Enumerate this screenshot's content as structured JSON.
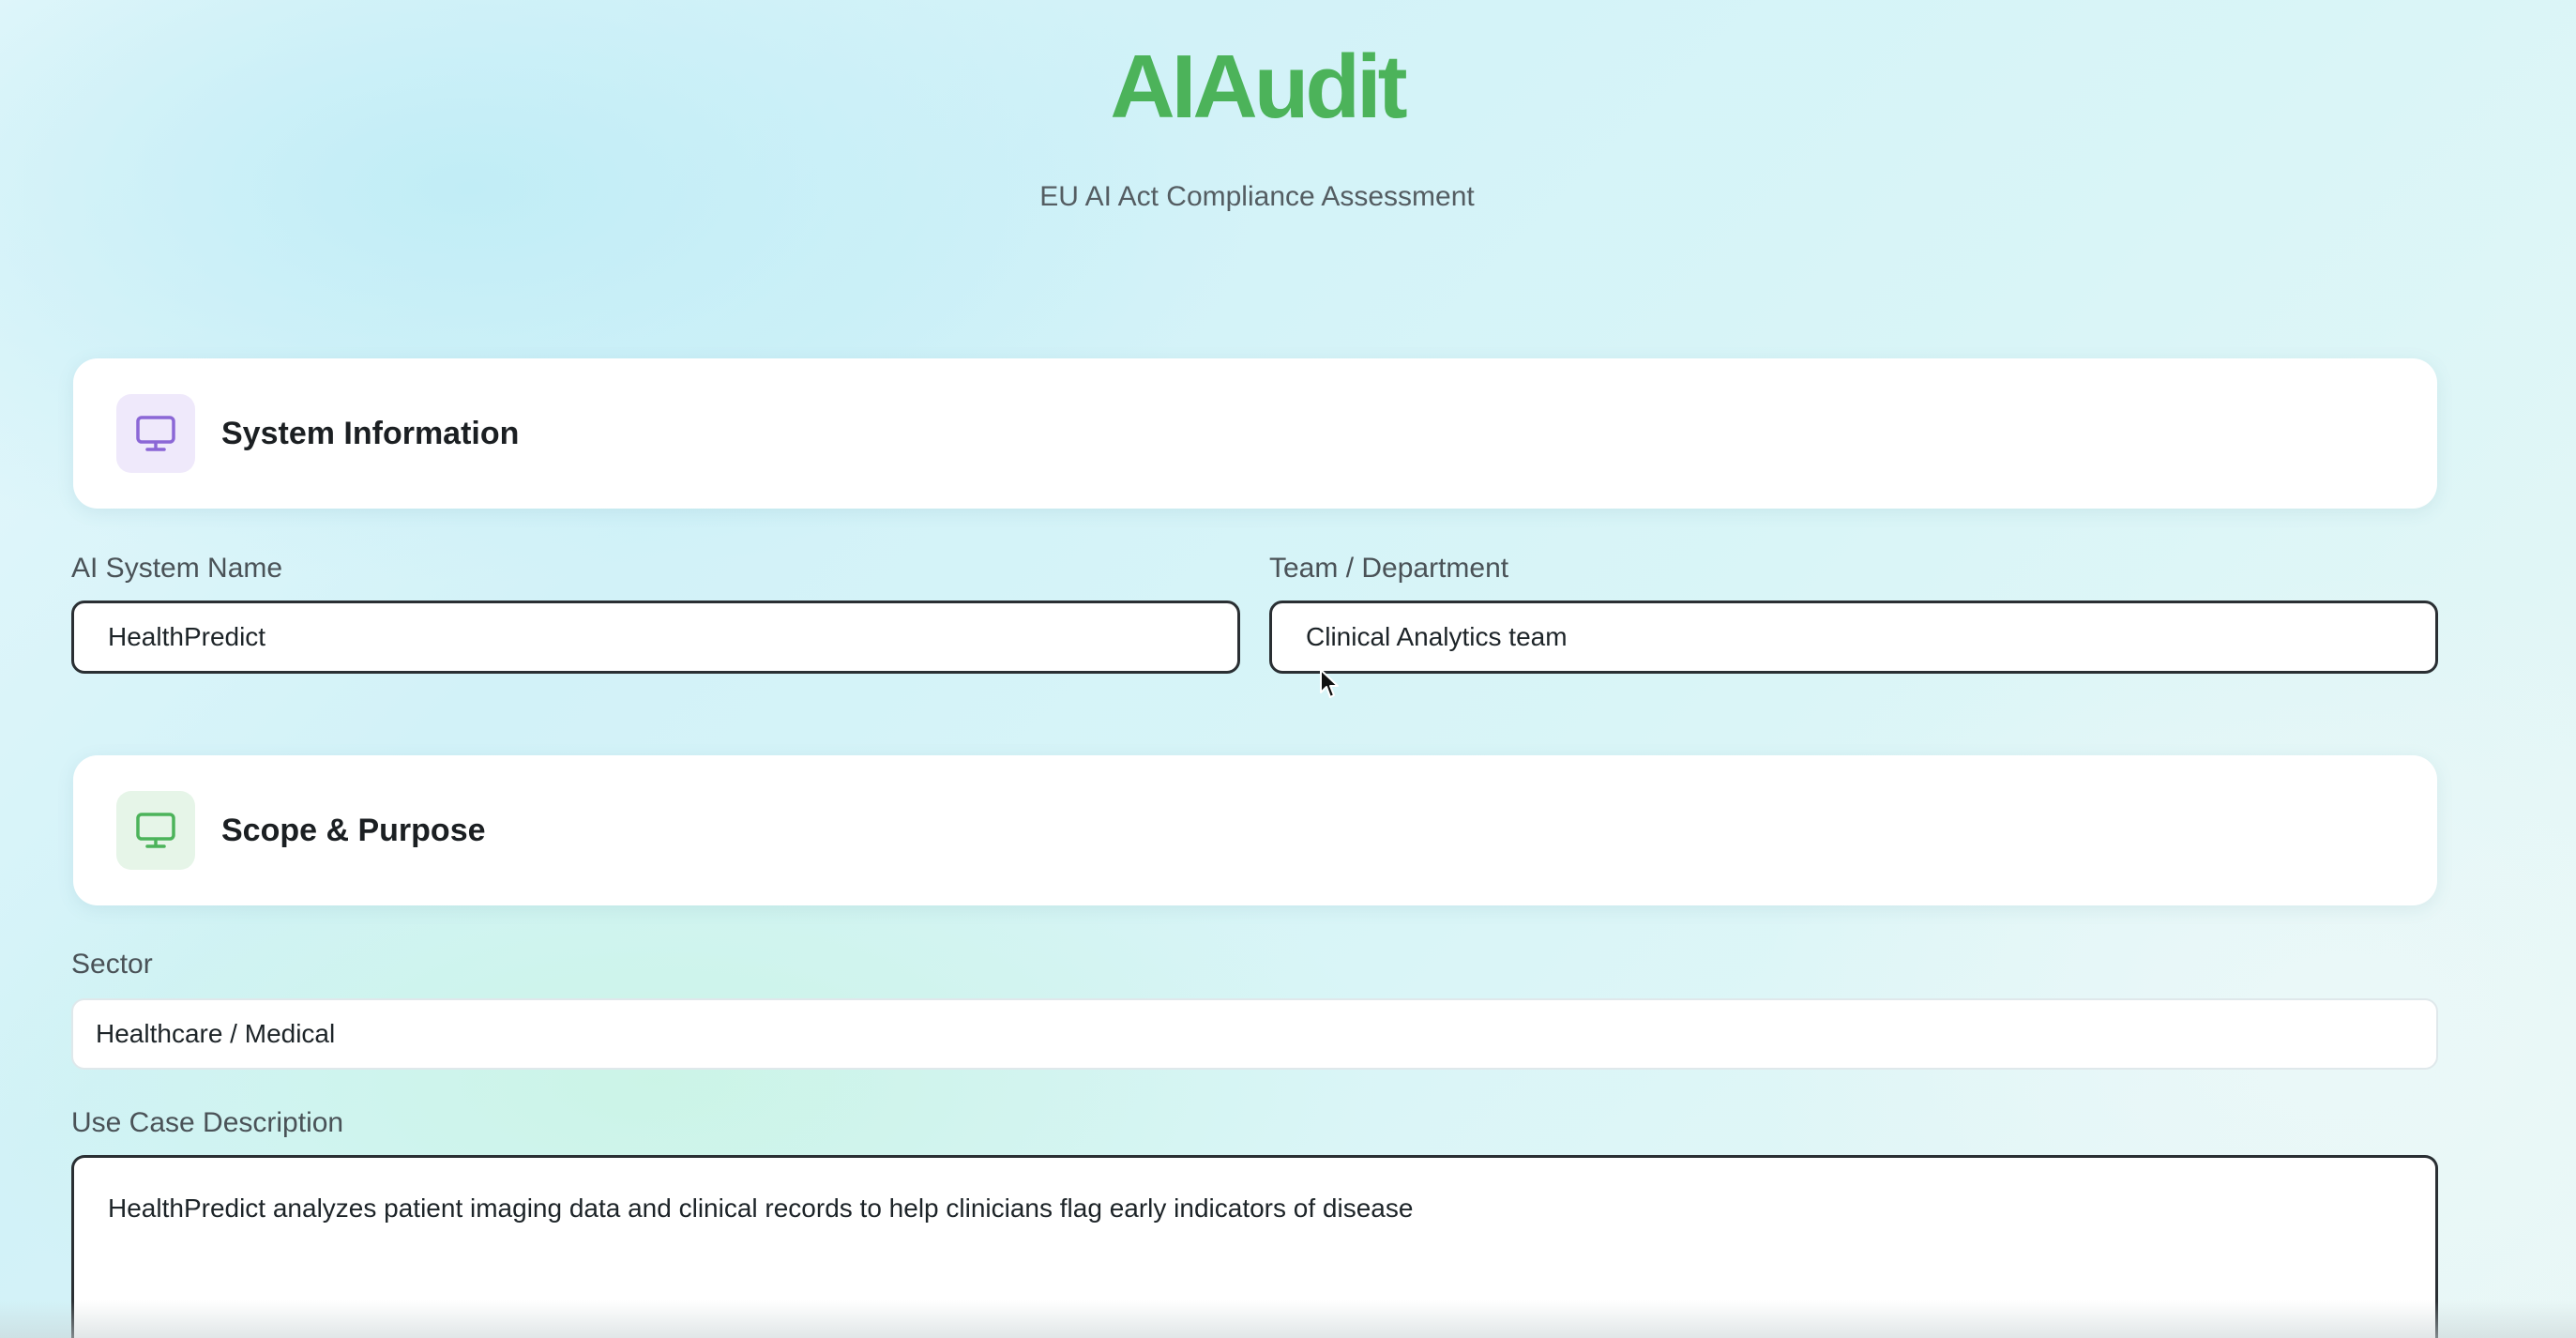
{
  "app": {
    "brand": "AIAudit",
    "tagline": "EU AI Act Compliance Assessment"
  },
  "sections": {
    "system_information": {
      "title": "System Information",
      "icon": "monitor-icon",
      "icon_color": "#8b67d6",
      "icon_bg": "#efe9fb"
    },
    "scope_purpose": {
      "title": "Scope & Purpose",
      "icon": "monitor-icon",
      "icon_color": "#4cb35a",
      "icon_bg": "#e6f5e8"
    }
  },
  "fields": {
    "system_name": {
      "label": "AI System Name",
      "value": "HealthPredict"
    },
    "team": {
      "label": "Team / Department",
      "value": "Clinical Analytics team"
    },
    "sector": {
      "label": "Sector",
      "value": "Healthcare / Medical"
    },
    "use_case": {
      "label": "Use Case Description",
      "value": "HealthPredict analyzes patient imaging data and clinical records to help clinicians flag early indicators of disease"
    }
  },
  "colors": {
    "brand": "#4cb35a"
  }
}
